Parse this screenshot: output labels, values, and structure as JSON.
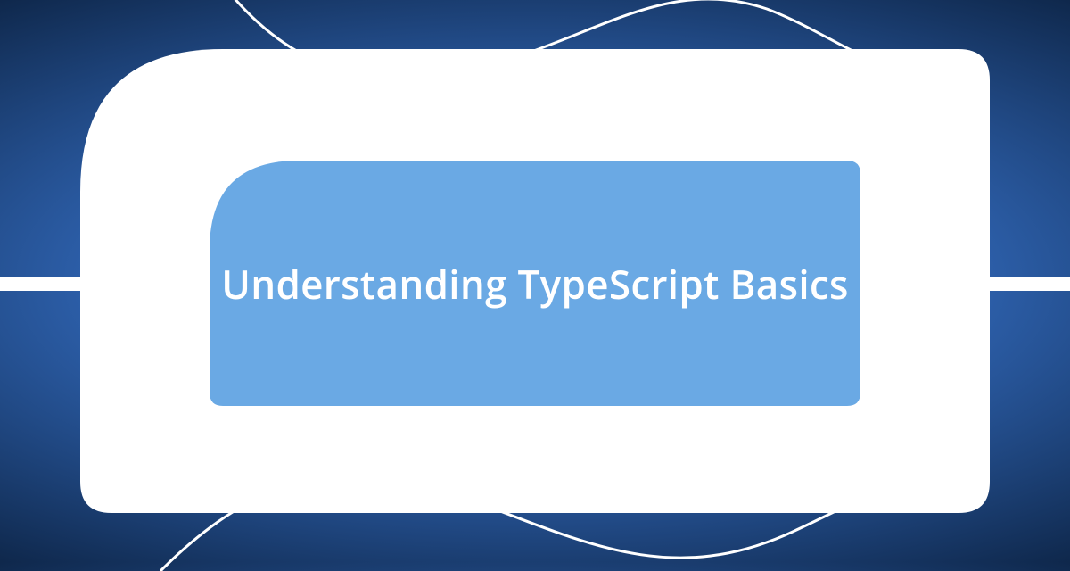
{
  "card": {
    "title": "Understanding TypeScript Basics"
  },
  "colors": {
    "inner_bg": "#6aa9e4",
    "outer_bg": "#ffffff",
    "title_color": "#ffffff"
  }
}
